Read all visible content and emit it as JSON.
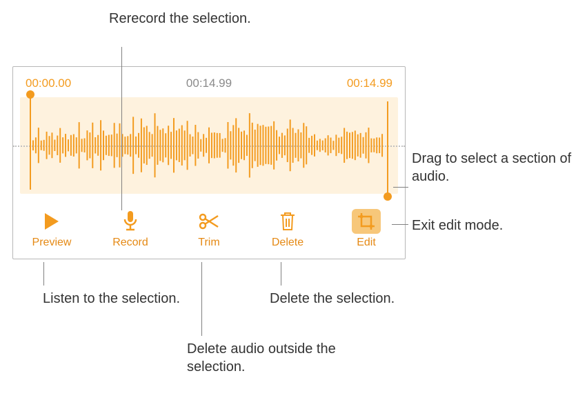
{
  "callouts": {
    "rerecord": "Rerecord the selection.",
    "drag_select": "Drag to select a section of audio.",
    "exit_edit": "Exit edit mode.",
    "listen": "Listen to the selection.",
    "trim": "Delete audio outside the selection.",
    "delete": "Delete the selection."
  },
  "timecodes": {
    "start": "00:00.00",
    "playhead": "00:14.99",
    "end": "00:14.99"
  },
  "toolbar": {
    "preview": "Preview",
    "record": "Record",
    "trim": "Trim",
    "delete": "Delete",
    "edit": "Edit"
  },
  "colors": {
    "accent": "#f39b1f",
    "selection_bg": "#fef2de"
  }
}
